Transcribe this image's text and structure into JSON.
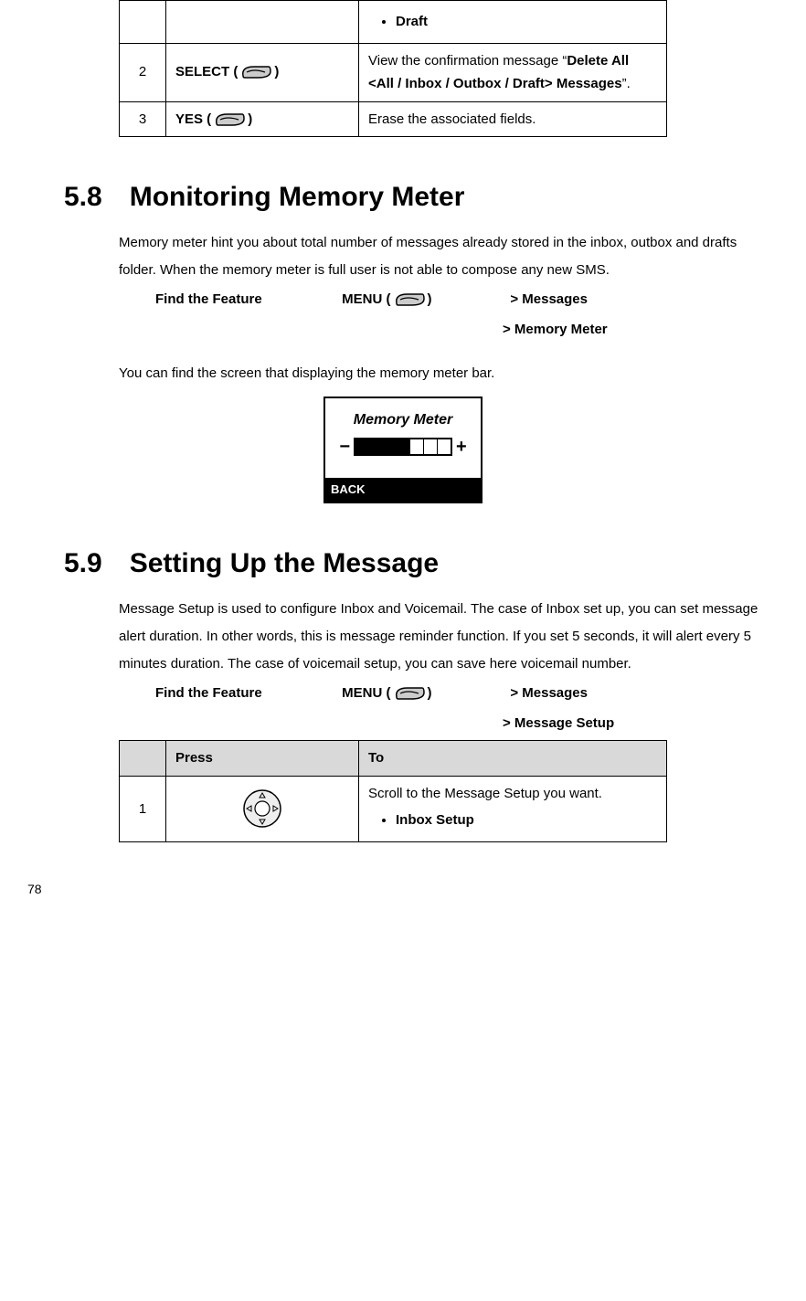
{
  "table1": {
    "row0": {
      "bullet": "Draft"
    },
    "row2": {
      "num": "2",
      "press": "SELECT",
      "to_a": "View the confirmation message “",
      "to_b": "Delete All <All / Inbox / Outbox / Draft> Messages",
      "to_c": "”."
    },
    "row3": {
      "num": "3",
      "press": "YES",
      "to": "Erase the associated fields."
    }
  },
  "sec58": {
    "heading": "5.8 Monitoring Memory Meter",
    "para": "Memory meter hint you about total number of messages already stored in the inbox, outbox and drafts folder. When the memory meter is full user is not able to compose any new SMS.",
    "findlabel": "Find the Feature",
    "menu": "MENU",
    "path1": "> Messages",
    "path2": "> Memory Meter",
    "after": "You can find the screen that displaying the memory meter bar.",
    "screen_title": "Memory Meter",
    "screen_back": "BACK"
  },
  "sec59": {
    "heading": "5.9 Setting Up the Message",
    "para": "Message Setup is used to configure Inbox and Voicemail. The case of Inbox set up, you can set message alert duration. In other words, this is message reminder function. If you set 5 seconds, it will alert every 5 minutes duration. The case of voicemail setup, you can save here voicemail number.",
    "findlabel": "Find the Feature",
    "menu": "MENU",
    "path1": "> Messages",
    "path2": "> Message Setup",
    "thPress": "Press",
    "thTo": "To",
    "row1": {
      "num": "1",
      "to_a": "Scroll to the Message Setup you want.",
      "bullet": "Inbox Setup"
    }
  },
  "pagenum": "78"
}
